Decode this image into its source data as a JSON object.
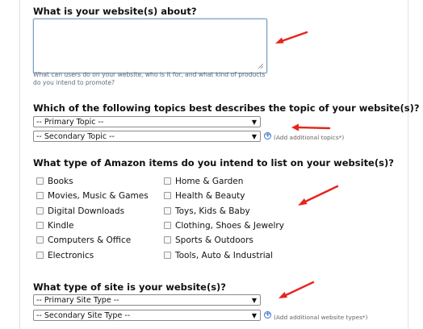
{
  "website_about": {
    "question": "What is your website(s) about?",
    "value": "",
    "hint": "What can users do on your website, who is it for, and what kind of products do you intend to promote?"
  },
  "topics": {
    "question": "Which of the following topics best describes the topic of your website(s)?",
    "primary": "-- Primary Topic --",
    "secondary": "-- Secondary Topic --",
    "add_link": "(Add additional topics*)"
  },
  "items": {
    "question": "What type of Amazon items do you intend to list on your website(s)?",
    "left": [
      "Books",
      "Movies, Music & Games",
      "Digital Downloads",
      "Kindle",
      "Computers & Office",
      "Electronics"
    ],
    "right": [
      "Home & Garden",
      "Health & Beauty",
      "Toys, Kids & Baby",
      "Clothing, Shoes & Jewelry",
      "Sports & Outdoors",
      "Tools, Auto & Industrial"
    ]
  },
  "site_type": {
    "question": "What type of site is your website(s)?",
    "primary": "-- Primary Site Type --",
    "secondary": "-- Secondary Site Type --",
    "add_link": "(Add additional website types*)"
  },
  "colors": {
    "arrow": "#e8231b",
    "focus_border": "#7f9db9",
    "link_blue": "#3a6fc4"
  }
}
